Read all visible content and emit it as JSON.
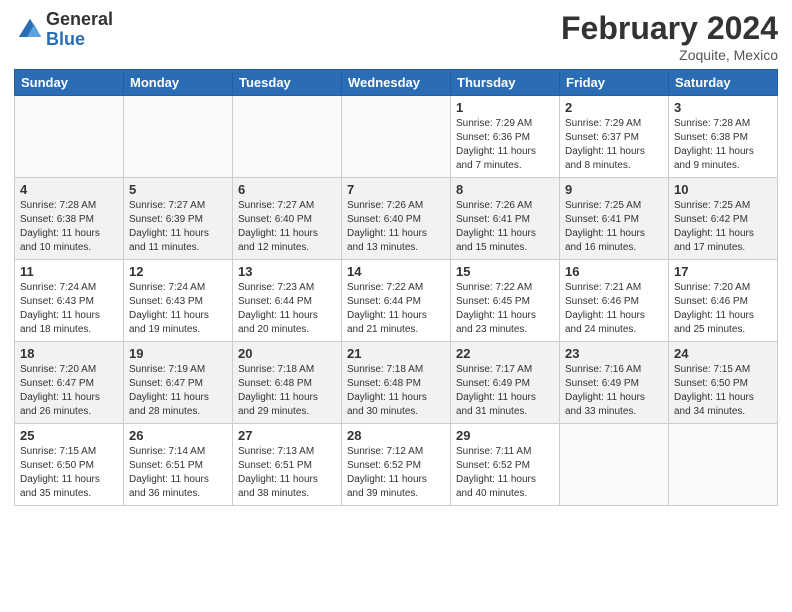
{
  "logo": {
    "general": "General",
    "blue": "Blue"
  },
  "title": "February 2024",
  "subtitle": "Zoquite, Mexico",
  "days_of_week": [
    "Sunday",
    "Monday",
    "Tuesday",
    "Wednesday",
    "Thursday",
    "Friday",
    "Saturday"
  ],
  "weeks": [
    [
      {
        "num": "",
        "info": ""
      },
      {
        "num": "",
        "info": ""
      },
      {
        "num": "",
        "info": ""
      },
      {
        "num": "",
        "info": ""
      },
      {
        "num": "1",
        "info": "Sunrise: 7:29 AM\nSunset: 6:36 PM\nDaylight: 11 hours and 7 minutes."
      },
      {
        "num": "2",
        "info": "Sunrise: 7:29 AM\nSunset: 6:37 PM\nDaylight: 11 hours and 8 minutes."
      },
      {
        "num": "3",
        "info": "Sunrise: 7:28 AM\nSunset: 6:38 PM\nDaylight: 11 hours and 9 minutes."
      }
    ],
    [
      {
        "num": "4",
        "info": "Sunrise: 7:28 AM\nSunset: 6:38 PM\nDaylight: 11 hours and 10 minutes."
      },
      {
        "num": "5",
        "info": "Sunrise: 7:27 AM\nSunset: 6:39 PM\nDaylight: 11 hours and 11 minutes."
      },
      {
        "num": "6",
        "info": "Sunrise: 7:27 AM\nSunset: 6:40 PM\nDaylight: 11 hours and 12 minutes."
      },
      {
        "num": "7",
        "info": "Sunrise: 7:26 AM\nSunset: 6:40 PM\nDaylight: 11 hours and 13 minutes."
      },
      {
        "num": "8",
        "info": "Sunrise: 7:26 AM\nSunset: 6:41 PM\nDaylight: 11 hours and 15 minutes."
      },
      {
        "num": "9",
        "info": "Sunrise: 7:25 AM\nSunset: 6:41 PM\nDaylight: 11 hours and 16 minutes."
      },
      {
        "num": "10",
        "info": "Sunrise: 7:25 AM\nSunset: 6:42 PM\nDaylight: 11 hours and 17 minutes."
      }
    ],
    [
      {
        "num": "11",
        "info": "Sunrise: 7:24 AM\nSunset: 6:43 PM\nDaylight: 11 hours and 18 minutes."
      },
      {
        "num": "12",
        "info": "Sunrise: 7:24 AM\nSunset: 6:43 PM\nDaylight: 11 hours and 19 minutes."
      },
      {
        "num": "13",
        "info": "Sunrise: 7:23 AM\nSunset: 6:44 PM\nDaylight: 11 hours and 20 minutes."
      },
      {
        "num": "14",
        "info": "Sunrise: 7:22 AM\nSunset: 6:44 PM\nDaylight: 11 hours and 21 minutes."
      },
      {
        "num": "15",
        "info": "Sunrise: 7:22 AM\nSunset: 6:45 PM\nDaylight: 11 hours and 23 minutes."
      },
      {
        "num": "16",
        "info": "Sunrise: 7:21 AM\nSunset: 6:46 PM\nDaylight: 11 hours and 24 minutes."
      },
      {
        "num": "17",
        "info": "Sunrise: 7:20 AM\nSunset: 6:46 PM\nDaylight: 11 hours and 25 minutes."
      }
    ],
    [
      {
        "num": "18",
        "info": "Sunrise: 7:20 AM\nSunset: 6:47 PM\nDaylight: 11 hours and 26 minutes."
      },
      {
        "num": "19",
        "info": "Sunrise: 7:19 AM\nSunset: 6:47 PM\nDaylight: 11 hours and 28 minutes."
      },
      {
        "num": "20",
        "info": "Sunrise: 7:18 AM\nSunset: 6:48 PM\nDaylight: 11 hours and 29 minutes."
      },
      {
        "num": "21",
        "info": "Sunrise: 7:18 AM\nSunset: 6:48 PM\nDaylight: 11 hours and 30 minutes."
      },
      {
        "num": "22",
        "info": "Sunrise: 7:17 AM\nSunset: 6:49 PM\nDaylight: 11 hours and 31 minutes."
      },
      {
        "num": "23",
        "info": "Sunrise: 7:16 AM\nSunset: 6:49 PM\nDaylight: 11 hours and 33 minutes."
      },
      {
        "num": "24",
        "info": "Sunrise: 7:15 AM\nSunset: 6:50 PM\nDaylight: 11 hours and 34 minutes."
      }
    ],
    [
      {
        "num": "25",
        "info": "Sunrise: 7:15 AM\nSunset: 6:50 PM\nDaylight: 11 hours and 35 minutes."
      },
      {
        "num": "26",
        "info": "Sunrise: 7:14 AM\nSunset: 6:51 PM\nDaylight: 11 hours and 36 minutes."
      },
      {
        "num": "27",
        "info": "Sunrise: 7:13 AM\nSunset: 6:51 PM\nDaylight: 11 hours and 38 minutes."
      },
      {
        "num": "28",
        "info": "Sunrise: 7:12 AM\nSunset: 6:52 PM\nDaylight: 11 hours and 39 minutes."
      },
      {
        "num": "29",
        "info": "Sunrise: 7:11 AM\nSunset: 6:52 PM\nDaylight: 11 hours and 40 minutes."
      },
      {
        "num": "",
        "info": ""
      },
      {
        "num": "",
        "info": ""
      }
    ]
  ]
}
